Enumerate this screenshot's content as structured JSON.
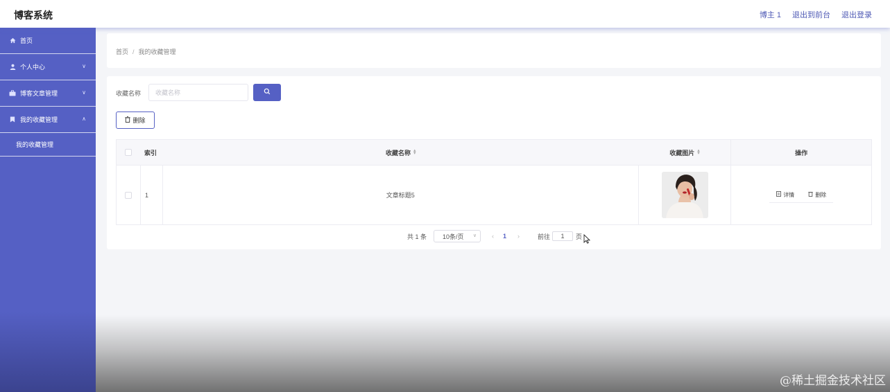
{
  "header": {
    "app_title": "博客系统",
    "links": [
      "博主 1",
      "退出到前台",
      "退出登录"
    ]
  },
  "sidebar": {
    "items": [
      {
        "label": "首页",
        "icon": "home-icon"
      },
      {
        "label": "个人中心",
        "icon": "user-icon"
      },
      {
        "label": "博客文章管理",
        "icon": "briefcase-icon"
      },
      {
        "label": "我的收藏管理",
        "icon": "bookmark-icon"
      }
    ],
    "submenu_label": "我的收藏管理"
  },
  "breadcrumb": {
    "home": "首页",
    "separator": "/",
    "current": "我的收藏管理"
  },
  "search": {
    "label": "收藏名称",
    "placeholder": "收藏名称",
    "value": ""
  },
  "toolbar": {
    "delete_label": "删除"
  },
  "table": {
    "columns": [
      "索引",
      "收藏名称",
      "收藏图片",
      "操作"
    ],
    "rows": [
      {
        "index": "1",
        "name": "文章标题5",
        "image": "photo-thumbnail"
      }
    ],
    "actions": {
      "detail": "详情",
      "delete": "删除"
    }
  },
  "pagination": {
    "total_text": "共 1 条",
    "page_size": "10条/页",
    "current_page": "1",
    "goto_label": "前往",
    "goto_value": "1",
    "page_unit": "页"
  },
  "watermark": "@稀土掘金技术社区",
  "colors": {
    "accent": "#5560c4",
    "sidebar_bg": "#5560c4",
    "page_bg": "#f4f5f8"
  }
}
